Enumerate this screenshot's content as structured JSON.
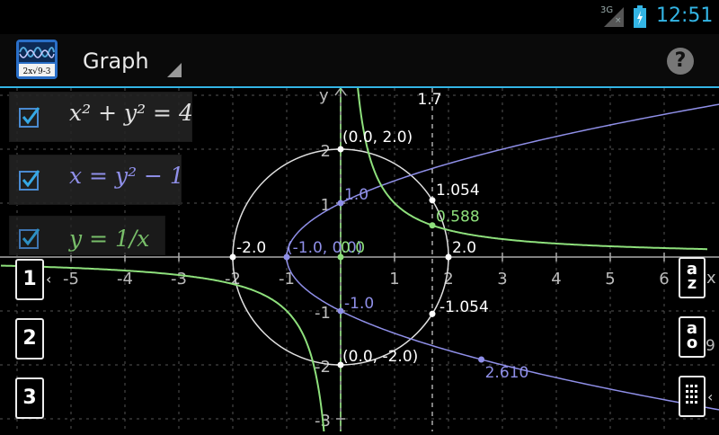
{
  "status_bar": {
    "network": "3G",
    "network_flag": "×",
    "time": "12:51",
    "clock_color": "#33b5e5"
  },
  "action_bar": {
    "title": "Graph",
    "help_label": "?",
    "accent": "#33b5e5"
  },
  "equations": [
    {
      "label": "x² + y² = 4",
      "checked": true,
      "color": "#e0e0e0"
    },
    {
      "label": "x = y² − 1",
      "checked": true,
      "color": "#8f8fe8"
    },
    {
      "label": "y = 1/x",
      "checked": true,
      "color": "#8ee07c"
    }
  ],
  "left_buttons": [
    "1",
    "2",
    "3"
  ],
  "right_buttons": [
    {
      "name": "az-toggle-button",
      "label": "a z"
    },
    {
      "name": "ao-toggle-button",
      "label": "a o"
    },
    {
      "name": "keypad-button",
      "label": "keypad"
    }
  ],
  "chart_data": {
    "type": "line",
    "xlabel": "x",
    "ylabel": "y",
    "xlim": [
      -6.3,
      6.8
    ],
    "ylim": [
      -3.1,
      3.2
    ],
    "x_ticks": [
      -5,
      -4,
      -3,
      -2,
      -1,
      1,
      2,
      3,
      4,
      5,
      6
    ],
    "y_ticks": [
      -3,
      -2,
      -1,
      1,
      2
    ],
    "grid": true,
    "trace_x": 1.7,
    "trace_label": "1.7",
    "series": [
      {
        "name": "x² + y² = 4",
        "kind": "circle",
        "r": 2,
        "color": "#e0e0e0"
      },
      {
        "name": "x = y² − 1",
        "kind": "parabola_x",
        "color": "#8f8fe8"
      },
      {
        "name": "y = 1/x",
        "kind": "hyperbola",
        "color": "#8ee07c"
      }
    ],
    "points": [
      {
        "x": 0.0,
        "y": 2.0,
        "label": "(0.0, 2.0)",
        "color": "#ffffff"
      },
      {
        "x": 0.0,
        "y": -2.0,
        "label": "(0.0, -2.0)",
        "color": "#ffffff"
      },
      {
        "x": -2.0,
        "y": 0.0,
        "label": "-2.0",
        "color": "#ffffff"
      },
      {
        "x": 2.0,
        "y": 0.0,
        "label": "2.0",
        "color": "#ffffff"
      },
      {
        "x": 1.7,
        "y": 1.054,
        "label": "1.054",
        "color": "#ffffff"
      },
      {
        "x": 1.7,
        "y": -1.054,
        "label": "-1.054",
        "color": "#ffffff"
      },
      {
        "x": 0.0,
        "y": 1.0,
        "label": "1.0",
        "color": "#8f8fe8"
      },
      {
        "x": 0.0,
        "y": -1.0,
        "label": "-1.0",
        "color": "#8f8fe8"
      },
      {
        "x": -1.0,
        "y": 0.0,
        "label": "(-1.0, 0.0)",
        "color": "#8f8fe8"
      },
      {
        "x": 2.61,
        "y": -1.9,
        "label": "2.610",
        "color": "#8f8fe8"
      },
      {
        "x": 0.0,
        "y": 0.0,
        "label": "0.0",
        "color": "#8ee07c"
      },
      {
        "x": 1.7,
        "y": 0.588,
        "label": "0.588",
        "color": "#8ee07c"
      }
    ],
    "edge_labels": [
      "9"
    ]
  }
}
